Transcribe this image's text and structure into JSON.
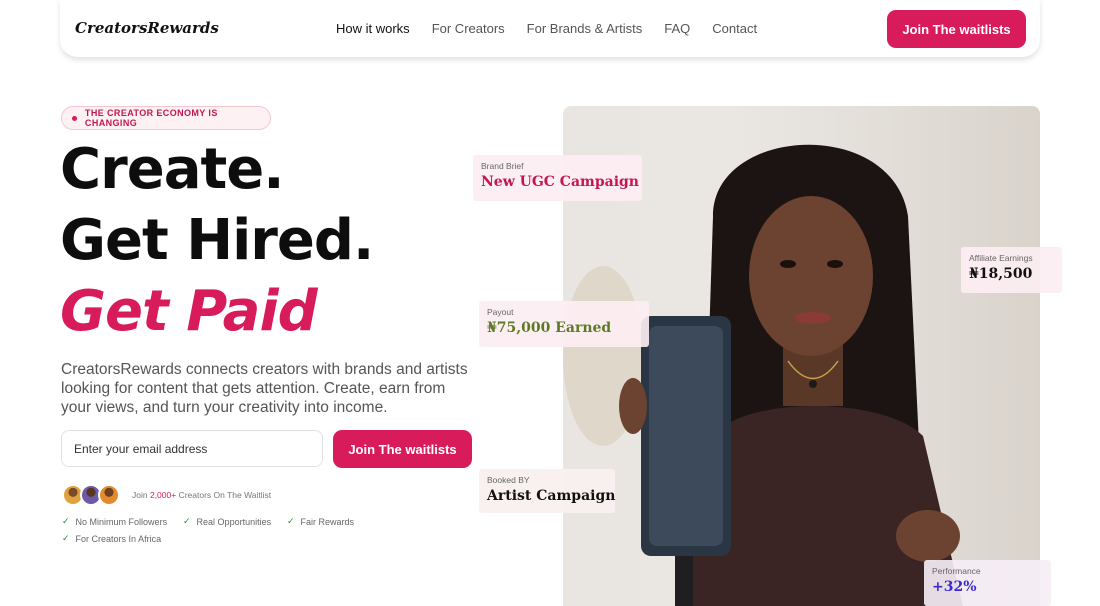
{
  "nav": {
    "logo": "CreatorsRewards",
    "links": [
      {
        "label": "How it works"
      },
      {
        "label": "For Creators"
      },
      {
        "label": "For Brands & Artists"
      },
      {
        "label": "FAQ"
      },
      {
        "label": "Contact"
      }
    ],
    "cta": "Join The waitlists"
  },
  "hero": {
    "badge": "THE CREATOR ECONOMY IS CHANGING",
    "headline": [
      "Create.",
      "Get Hired.",
      "Get Paid"
    ],
    "description": "CreatorsRewards connects creators with brands and artists looking for content that gets attention. Create, earn from your views, and turn your creativity into income.",
    "email_placeholder": "Enter your email address",
    "cta": "Join The waitlists",
    "join_prefix": "Join ",
    "join_count": "2,000+",
    "join_suffix": " Creators On The Waitlist",
    "checks": [
      "No Minimum Followers",
      "Real Opportunities",
      "Fair Rewards",
      "For Creators In Africa"
    ]
  },
  "cards": {
    "brief": {
      "label": "Brand Brief",
      "value": "New UGC Campaign"
    },
    "affiliate": {
      "label": "Affiliate Earnings",
      "value": "₦18,500"
    },
    "payout": {
      "label": "Payout",
      "value": "₦75,000 Earned"
    },
    "booked": {
      "label": "Booked BY",
      "value": "Artist Campaign"
    },
    "performance": {
      "label": "Performance",
      "value": "+32%"
    }
  },
  "colors": {
    "accent": "#d81b5b",
    "payout_green": "#5e7a26",
    "performance_blue": "#3a2bd1"
  }
}
